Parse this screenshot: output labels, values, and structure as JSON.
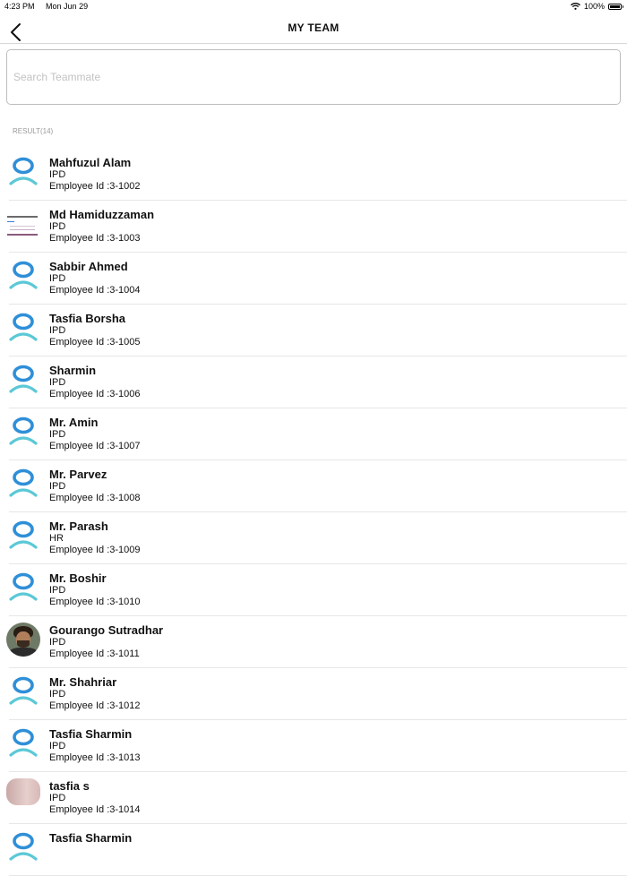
{
  "status_bar": {
    "time": "4:23 PM",
    "date": "Mon Jun 29",
    "battery": "100%",
    "battery_level": 1.0
  },
  "nav": {
    "title": "MY TEAM"
  },
  "search": {
    "placeholder": "Search Teammate",
    "value": ""
  },
  "result_label": "RESULT(14)",
  "colors": {
    "avatar_head": "#2f8fd8",
    "avatar_body": "#5cc8d6",
    "separator": "#e6e6e6"
  },
  "members": [
    {
      "name": "Mahfuzul Alam",
      "dept": "IPD",
      "employee_id": "Employee Id :3-1002",
      "avatar": "default-avatar-icon"
    },
    {
      "name": "Md Hamiduzzaman",
      "dept": "IPD",
      "employee_id": "Employee Id :3-1003",
      "avatar": "screenshot-photo"
    },
    {
      "name": "Sabbir Ahmed",
      "dept": "IPD",
      "employee_id": "Employee Id :3-1004",
      "avatar": "default-avatar-icon"
    },
    {
      "name": "Tasfia Borsha",
      "dept": "IPD",
      "employee_id": "Employee Id :3-1005",
      "avatar": "default-avatar-icon"
    },
    {
      "name": "Sharmin",
      "dept": "IPD",
      "employee_id": "Employee Id :3-1006",
      "avatar": "default-avatar-icon"
    },
    {
      "name": "Mr. Amin",
      "dept": "IPD",
      "employee_id": "Employee Id :3-1007",
      "avatar": "default-avatar-icon"
    },
    {
      "name": "Mr. Parvez",
      "dept": "IPD",
      "employee_id": "Employee Id :3-1008",
      "avatar": "default-avatar-icon"
    },
    {
      "name": "Mr. Parash",
      "dept": "HR",
      "employee_id": "Employee Id :3-1009",
      "avatar": "default-avatar-icon"
    },
    {
      "name": "Mr. Boshir",
      "dept": "IPD",
      "employee_id": "Employee Id :3-1010",
      "avatar": "default-avatar-icon"
    },
    {
      "name": "Gourango Sutradhar",
      "dept": "IPD",
      "employee_id": "Employee Id :3-1011",
      "avatar": "profile-photo"
    },
    {
      "name": "Mr. Shahriar",
      "dept": "IPD",
      "employee_id": "Employee Id :3-1012",
      "avatar": "default-avatar-icon"
    },
    {
      "name": "Tasfia Sharmin",
      "dept": "IPD",
      "employee_id": "Employee Id :3-1013",
      "avatar": "default-avatar-icon"
    },
    {
      "name": "tasfia s",
      "dept": "IPD",
      "employee_id": "Employee Id :3-1014",
      "avatar": "pink-photo"
    },
    {
      "name": "Tasfia Sharmin",
      "dept": "",
      "employee_id": "",
      "avatar": "default-avatar-icon"
    }
  ]
}
